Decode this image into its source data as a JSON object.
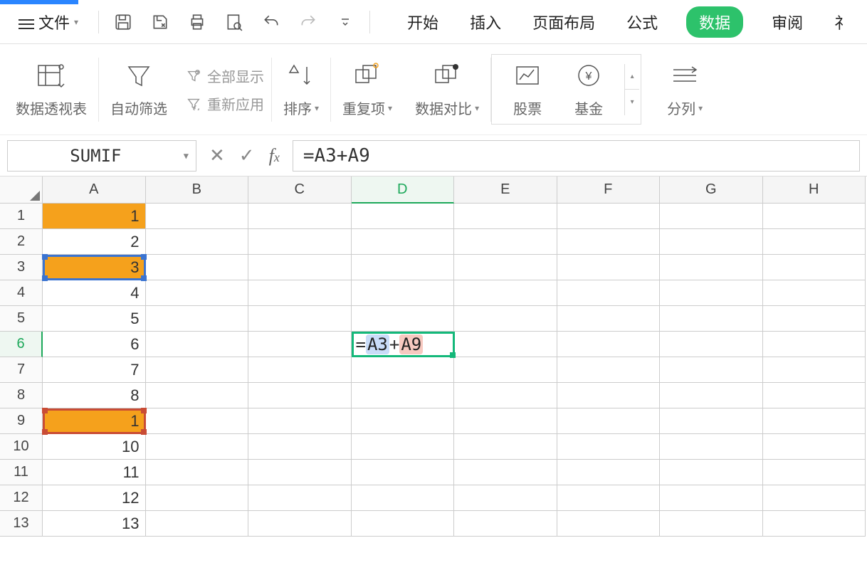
{
  "menu": {
    "file": "文件",
    "tabs": [
      "开始",
      "插入",
      "页面布局",
      "公式",
      "数据",
      "审阅"
    ],
    "truncated": "礻",
    "active_tab_index": 4
  },
  "ribbon": {
    "pivot": "数据透视表",
    "autofilter": "自动筛选",
    "show_all": "全部显示",
    "reapply": "重新应用",
    "sort": "排序",
    "duplicates": "重复项",
    "compare": "数据对比",
    "stocks": "股票",
    "funds": "基金",
    "split": "分列"
  },
  "formula_bar": {
    "name_box": "SUMIF",
    "formula": "=A3+A9",
    "ref1": "A3",
    "ref2": "A9"
  },
  "columns": [
    "A",
    "B",
    "C",
    "D",
    "E",
    "F",
    "G",
    "H"
  ],
  "active_column_index": 3,
  "active_row_index": 5,
  "cells": {
    "A": [
      "1",
      "2",
      "3",
      "4",
      "5",
      "6",
      "7",
      "8",
      "1",
      "10",
      "11",
      "12",
      "13"
    ],
    "D6_prefix": "=",
    "D6_mid": "+"
  },
  "highlighted_rows_A": {
    "0": true,
    "2": true,
    "8": true
  },
  "row_count": 13
}
